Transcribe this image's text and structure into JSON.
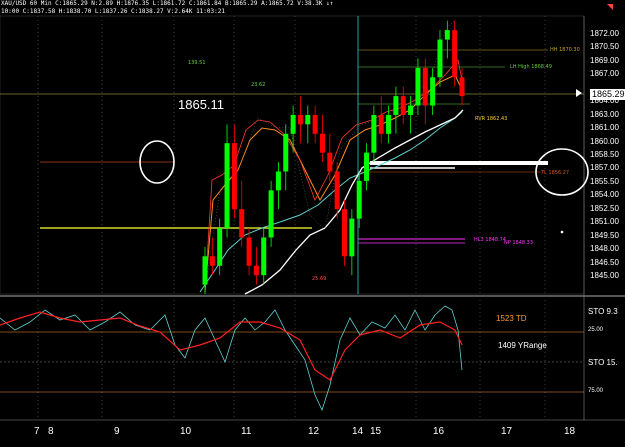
{
  "header": {
    "line1": "XAU/USD 60 Min  C:1865.29  N:2.89  H:1876.35  L:1861.72  C:1861.84  B:1865.29  A:1865.72  V:38.3K  ↓↑",
    "line2": "10:00  C:1837.58  H:1838.70  L:1837.26  C:1838.27  V:2.64K  11:03:21"
  },
  "big_price_label": "1865.11",
  "current_price": "1865.29",
  "y_axis_ticks": [
    "1872.00",
    "1870.50",
    "1869.00",
    "1867.00",
    "1865.29",
    "1864.00",
    "1863.00",
    "1861.00",
    "1860.00",
    "1858.50",
    "1857.00",
    "1855.50",
    "1854.00",
    "1852.50",
    "1851.00",
    "1849.50",
    "1848.00",
    "1846.50",
    "1845.00"
  ],
  "x_axis_labels": [
    "7",
    "8",
    "9",
    "10",
    "11",
    "12",
    "14",
    "15",
    "16",
    "17",
    "18"
  ],
  "annotations": {
    "h1": "139.51",
    "h2": "23.62",
    "low": "25.69",
    "hh": "HH 1870.30",
    "lh": "LH High 1868.49",
    "rvr": "RVR 1862.43",
    "tl": "TL 1856.27",
    "hl3": "HL3 1848.74",
    "np": "NP 1848.33"
  },
  "oscillator": {
    "td": "1523 TD",
    "yrange": "1409 YRange",
    "sto_top": "STO  9.3",
    "sto_bottom": "STO  15.",
    "lvl_25": "25.00",
    "lvl_75": "75.00"
  },
  "colors": {
    "bull": "#00ff00",
    "bear": "#ff0000",
    "ma_orange": "#ff8c1a",
    "ma_red": "#ff3b30",
    "ma_cyan": "#5fd0d0",
    "ma_white": "#ffffff",
    "yellow": "#ffff33",
    "cyan_vertical": "#33cccc",
    "magenta": "#ff33ff",
    "grid_dots": "#777777"
  },
  "chart_data": {
    "type": "candlestick",
    "ylim": [
      1844,
      1873.5
    ],
    "note_levels": [
      1870.3,
      1868.49,
      1862.43,
      1856.27,
      1848.74,
      1848.33
    ],
    "ohlc": [
      [
        1845,
        1849,
        1844,
        1848
      ],
      [
        1848,
        1850,
        1846,
        1847
      ],
      [
        1847,
        1852,
        1846,
        1851
      ],
      [
        1851,
        1862,
        1850,
        1860
      ],
      [
        1860,
        1862,
        1852,
        1853
      ],
      [
        1853,
        1856,
        1849,
        1850
      ],
      [
        1850,
        1851,
        1846,
        1847
      ],
      [
        1847,
        1849,
        1845,
        1846
      ],
      [
        1846,
        1851,
        1845,
        1850
      ],
      [
        1850,
        1856,
        1849,
        1855
      ],
      [
        1855,
        1858,
        1853,
        1857
      ],
      [
        1857,
        1862,
        1855,
        1861
      ],
      [
        1861,
        1864,
        1859,
        1863
      ],
      [
        1863,
        1865,
        1860,
        1862
      ],
      [
        1862,
        1864,
        1860,
        1863
      ],
      [
        1863,
        1864,
        1860,
        1861
      ],
      [
        1861,
        1863,
        1858,
        1859
      ],
      [
        1859,
        1861,
        1856,
        1857
      ],
      [
        1857,
        1858,
        1852,
        1853
      ],
      [
        1853,
        1854,
        1847,
        1848
      ],
      [
        1848,
        1853,
        1846,
        1852
      ],
      [
        1852,
        1857,
        1851,
        1856
      ],
      [
        1856,
        1860,
        1855,
        1859
      ],
      [
        1859,
        1864,
        1858,
        1863
      ],
      [
        1863,
        1865,
        1860,
        1861
      ],
      [
        1861,
        1864,
        1860,
        1863
      ],
      [
        1863,
        1866,
        1861,
        1865
      ],
      [
        1865,
        1866,
        1862,
        1863
      ],
      [
        1863,
        1865,
        1861,
        1864
      ],
      [
        1864,
        1869,
        1863,
        1868
      ],
      [
        1868,
        1869,
        1862,
        1864
      ],
      [
        1864,
        1868,
        1863,
        1867
      ],
      [
        1867,
        1872,
        1866,
        1871
      ],
      [
        1871,
        1873,
        1869,
        1872
      ],
      [
        1872,
        1873,
        1866,
        1867
      ],
      [
        1867,
        1868,
        1864,
        1865
      ]
    ]
  }
}
